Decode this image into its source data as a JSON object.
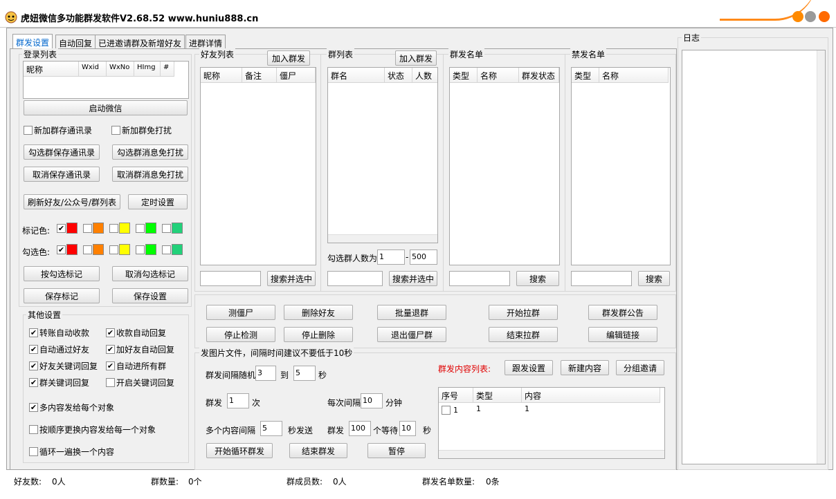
{
  "window": {
    "title": "虎妞微信多功能群发软件V2.68.52 www.huniu888.cn",
    "btn_colors": [
      "#ff8a00",
      "#9a9a9a",
      "#ff6a00"
    ]
  },
  "tabs": [
    "群发设置",
    "自动回复",
    "已进邀请群及新增好友",
    "进群详情"
  ],
  "login": {
    "title": "登录列表",
    "cols": [
      "昵称",
      "Wxid",
      "WxNo",
      "HImg",
      "#"
    ],
    "start": "启动微信"
  },
  "chk1": {
    "a": "新加群存通讯录",
    "b": "新加群免打扰"
  },
  "btns1": {
    "a": "勾选群保存通讯录",
    "b": "勾选群消息免打扰",
    "c": "取消保存通讯录",
    "d": "取消群消息免打扰",
    "e": "刷新好友/公众号/群列表",
    "f": "定时设置"
  },
  "colors": {
    "mark_label": "标记色:",
    "check_label": "勾选色:",
    "swatches": [
      "#ff0000",
      "#ff8000",
      "#ffff00",
      "#00ff00",
      "#22d17a"
    ]
  },
  "btns2": {
    "a": "按勾选标记",
    "b": "取消勾选标记",
    "c": "保存标记",
    "d": "保存设置"
  },
  "other": {
    "title": "其他设置",
    "items": [
      "转账自动收款",
      "收款自动回复",
      "自动通过好友",
      "加好友自动回复",
      "好友关键词回复",
      "自动进所有群",
      "群关键词回复",
      "开启关键词回复"
    ],
    "checked": [
      true,
      true,
      true,
      true,
      true,
      true,
      true,
      false
    ],
    "multi": "多内容发给每个对象",
    "seq": "按顺序更换内容发给每一个对象",
    "loop": "循环一遍换一个内容"
  },
  "friends": {
    "title": "好友列表",
    "add": "加入群发",
    "cols": [
      "昵称",
      "备注",
      "僵尸"
    ],
    "search": "搜索并选中"
  },
  "groups": {
    "title": "群列表",
    "add": "加入群发",
    "cols": [
      "群名",
      "状态",
      "人数"
    ],
    "count_label": "勾选群人数为",
    "min": "1",
    "max": "500",
    "search": "搜索并选中"
  },
  "sendlist": {
    "title": "群发名单",
    "cols": [
      "类型",
      "名称",
      "群发状态"
    ],
    "search": "搜索"
  },
  "banlist": {
    "title": "禁发名单",
    "cols": [
      "类型",
      "名称"
    ],
    "search": "搜索"
  },
  "actions": [
    "测僵尸",
    "删除好友",
    "批量退群",
    "开始拉群",
    "群发群公告",
    "停止检测",
    "停止删除",
    "退出僵尸群",
    "结束拉群",
    "编辑链接"
  ],
  "send": {
    "title": "发图片文件，间隔时间建议不要低于10秒",
    "interval_label": "群发间隔随机",
    "interval_min": "3",
    "to": "到",
    "interval_max": "5",
    "sec": "秒",
    "times_label": "群发",
    "times": "1",
    "times_unit": "次",
    "every_label": "每次间隔",
    "every": "10",
    "every_unit": "分钟",
    "multi_label": "多个内容间隔",
    "multi": "5",
    "multi_unit": "秒发送",
    "batch_label": "群发",
    "batch": "100",
    "wait_label": "个等待",
    "wait": "10",
    "wait_unit": "秒",
    "start": "开始循环群发",
    "stop": "结束群发",
    "pause": "暂停"
  },
  "content": {
    "title": "群发内容列表:",
    "follow": "跟发设置",
    "new": "新建内容",
    "invite": "分组邀请",
    "cols": [
      "序号",
      "类型",
      "内容"
    ],
    "row": [
      "1",
      "1",
      "1"
    ]
  },
  "log": {
    "title": "日志"
  },
  "status": {
    "friends": "好友数:",
    "friends_val": "0人",
    "groups": "群数量:",
    "groups_val": "0个",
    "members": "群成员数:",
    "members_val": "0人",
    "sendcount": "群发名单数量:",
    "sendcount_val": "0条"
  }
}
